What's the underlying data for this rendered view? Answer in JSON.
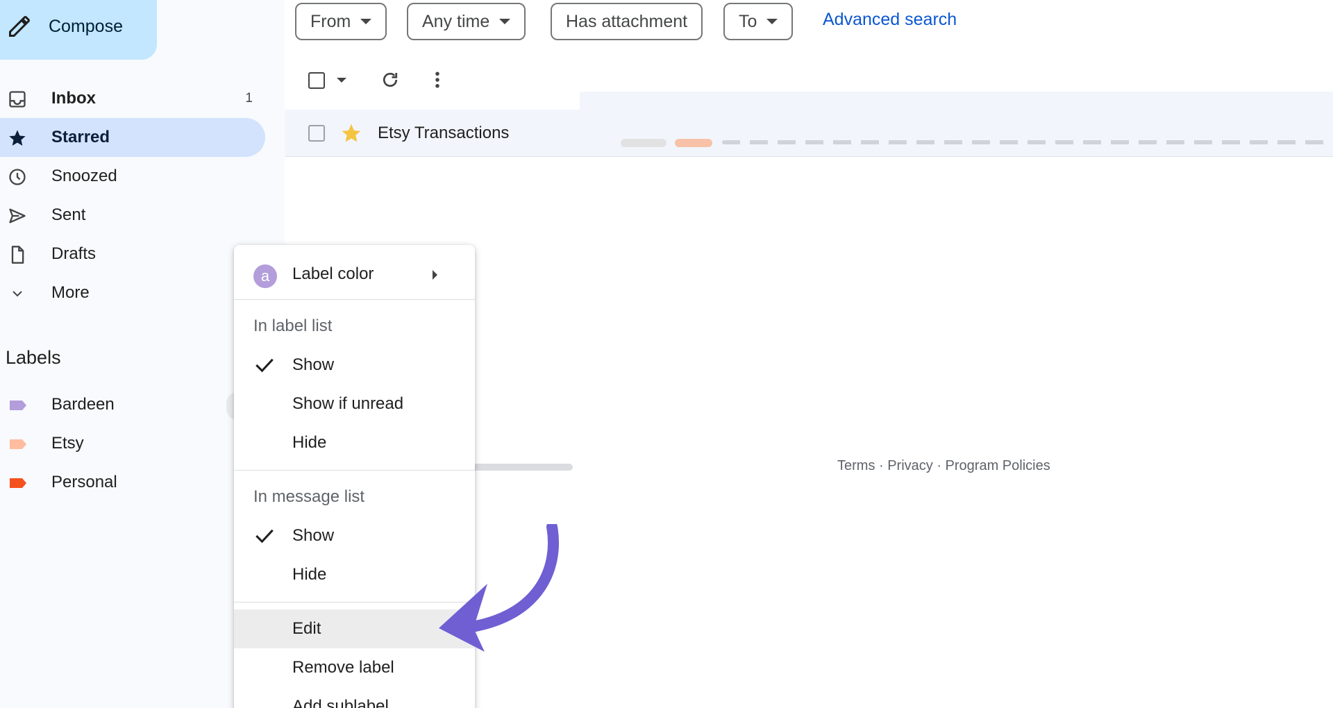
{
  "compose": {
    "label": "Compose",
    "icon": "pencil-icon"
  },
  "nav": [
    {
      "label": "Inbox",
      "count": "1",
      "icon": "inbox-icon"
    },
    {
      "label": "Starred",
      "icon": "star-icon"
    },
    {
      "label": "Snoozed",
      "icon": "clock-icon"
    },
    {
      "label": "Sent",
      "icon": "send-icon"
    },
    {
      "label": "Drafts",
      "icon": "draft-icon"
    },
    {
      "label": "More",
      "icon": "chevron-down-icon"
    }
  ],
  "labels": {
    "title": "Labels",
    "items": [
      {
        "label": "Bardeen",
        "color": "#b39ddb"
      },
      {
        "label": "Etsy",
        "color": "#ffbc9f"
      },
      {
        "label": "Personal",
        "color": "#f4511e"
      }
    ]
  },
  "filters": {
    "from": "From",
    "any_time": "Any time",
    "has_attachment": "Has attachment",
    "to": "To",
    "advanced_search": "Advanced search"
  },
  "email": {
    "sender": "Etsy Transactions",
    "starred": true
  },
  "footer": {
    "text": "Terms · Privacy · Program Policies"
  },
  "menu": {
    "label_color": "Label color",
    "avatar_letter": "a",
    "in_label_list": "In label list",
    "label_list_show": "Show",
    "label_list_show_if_unread": "Show if unread",
    "label_list_hide": "Hide",
    "in_message_list": "In message list",
    "message_list_show": "Show",
    "message_list_hide": "Hide",
    "edit": "Edit",
    "remove_label": "Remove label",
    "add_sublabel": "Add sublabel"
  },
  "colors": {
    "accent": "#0b57d0",
    "compose_bg": "#c2e7ff",
    "active_nav": "#d3e3fd",
    "arrow": "#6f5fd3"
  }
}
